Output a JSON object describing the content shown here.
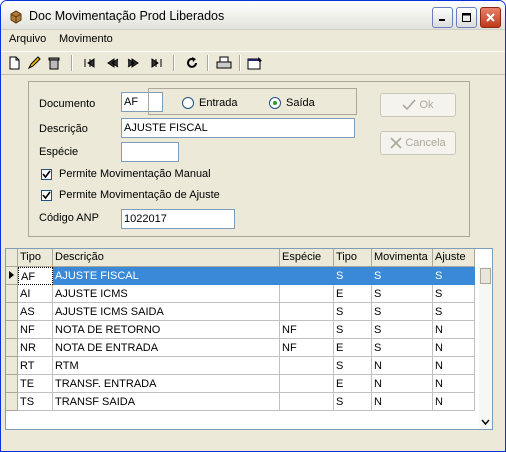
{
  "window": {
    "title": "Doc Movimentação  Prod Liberados"
  },
  "menu": [
    {
      "label": "Arquivo"
    },
    {
      "label": "Movimento"
    }
  ],
  "form": {
    "documento_label": "Documento",
    "documento_value": "AF",
    "radio_entrada": "Entrada",
    "radio_saida": "Saída",
    "selected_radio": "Saída",
    "descricao_label": "Descrição",
    "descricao_value": "AJUSTE FISCAL",
    "especie_label": "Espécie",
    "especie_value": "",
    "check_manual": "Permite Movimentação Manual",
    "check_ajuste": "Permite Movimentação de Ajuste",
    "codigo_label": "Código ANP",
    "codigo_value": "1022017",
    "ok_label": "Ok",
    "cancela_label": "Cancela"
  },
  "table": {
    "headers": [
      "Tipo",
      "Descrição",
      "Espécie",
      "Tipo",
      "Movimenta",
      "Ajuste"
    ],
    "rows": [
      [
        "AF",
        "AJUSTE FISCAL",
        "",
        "S",
        "S",
        "S"
      ],
      [
        "AI",
        "AJUSTE ICMS",
        "",
        "E",
        "S",
        "S"
      ],
      [
        "AS",
        "AJUSTE ICMS SAIDA",
        "",
        "S",
        "S",
        "S"
      ],
      [
        "NF",
        "NOTA DE RETORNO",
        "NF",
        "S",
        "S",
        "N"
      ],
      [
        "NR",
        "NOTA DE ENTRADA",
        "NF",
        "E",
        "S",
        "N"
      ],
      [
        "RT",
        "RTM",
        "",
        "S",
        "N",
        "N"
      ],
      [
        "TE",
        "TRANSF. ENTRADA",
        "",
        "E",
        "N",
        "N"
      ],
      [
        "TS",
        "TRANSF SAIDA",
        "",
        "S",
        "N",
        "N"
      ]
    ],
    "selected_row": 0
  }
}
